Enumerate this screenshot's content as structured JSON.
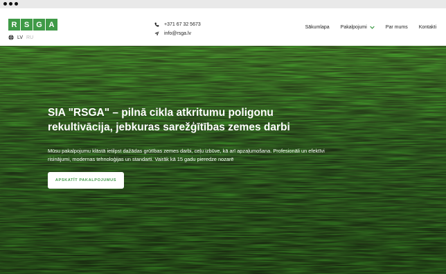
{
  "brand": {
    "logo_letters": [
      "R",
      "S",
      "G",
      "A"
    ],
    "accent_color": "#3f9a47"
  },
  "language": {
    "icon": "globe-icon",
    "active": "LV",
    "inactive": "RU"
  },
  "contact": {
    "phone": "+371 67 32 5673",
    "phone_icon": "phone-icon",
    "email": "info@rsga.lv",
    "email_icon": "send-icon"
  },
  "nav": {
    "items": [
      {
        "label": "Sākumlapa"
      },
      {
        "label": "Pakalpojumi",
        "has_dropdown": true
      },
      {
        "label": "Par mums"
      },
      {
        "label": "Kontakti"
      }
    ]
  },
  "hero": {
    "headline": "SIA \"RSGA\" – pilnā cikla atkritumu poligonu rekultivācija, jebkuras sarežģītības zemes darbi",
    "description": "Mūsu pakalpojumu klāstā ietilpst dažādas grūtības zemes darbi, ceļu izbūve, kā arī apzaļumošana. Profesionāli un efektīvi risinājumi, modernas tehnoloģijas un standarti. Vairāk kā 15 gadu pieredze nozarē",
    "cta_label": "APSKATĪT PAKALPOJUMUS"
  }
}
